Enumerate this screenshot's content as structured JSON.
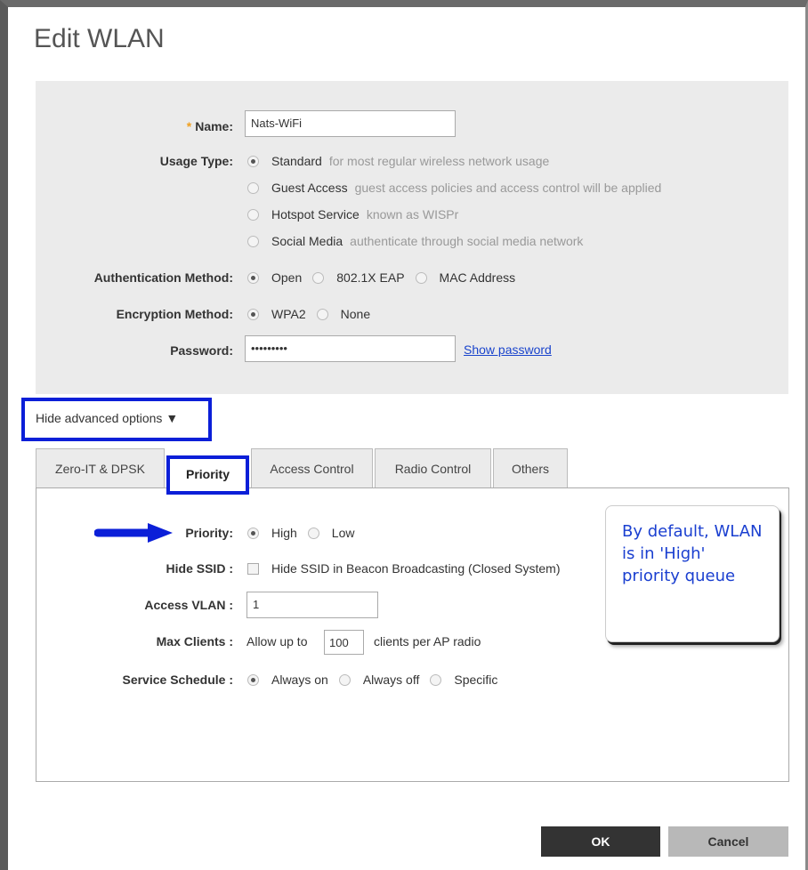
{
  "dialog": {
    "title": "Edit WLAN"
  },
  "general": {
    "name_label": "Name:",
    "name_required": "*",
    "name_value": "Nats-WiFi",
    "usage_label": "Usage Type:",
    "usage_options": [
      {
        "label": "Standard",
        "hint": "for most regular wireless network usage",
        "selected": true
      },
      {
        "label": "Guest Access",
        "hint": "guest access policies and access control will be applied",
        "selected": false
      },
      {
        "label": "Hotspot Service",
        "hint": "known as WISPr",
        "selected": false
      },
      {
        "label": "Social Media",
        "hint": "authenticate through social media network",
        "selected": false
      }
    ],
    "auth_label": "Authentication Method:",
    "auth_options": [
      "Open",
      "802.1X EAP",
      "MAC Address"
    ],
    "auth_selected": "Open",
    "enc_label": "Encryption Method:",
    "enc_options": [
      "WPA2",
      "None"
    ],
    "enc_selected": "WPA2",
    "password_label": "Password:",
    "password_value": "•••••••••",
    "show_password": "Show password"
  },
  "advanced": {
    "toggle_label": "Hide advanced options ▼",
    "tabs": [
      "Zero-IT & DPSK",
      "Priority",
      "Access Control",
      "Radio Control",
      "Others"
    ],
    "active_tab": "Priority"
  },
  "priority_tab": {
    "priority_label": "Priority:",
    "priority_options": [
      "High",
      "Low"
    ],
    "priority_selected": "High",
    "hide_ssid_label": "Hide SSID :",
    "hide_ssid_text": "Hide SSID in Beacon Broadcasting (Closed System)",
    "hide_ssid_checked": false,
    "vlan_label": "Access VLAN :",
    "vlan_value": "1",
    "max_clients_label": "Max Clients :",
    "max_clients_prefix": "Allow up to",
    "max_clients_value": "100",
    "max_clients_suffix": "clients per AP radio",
    "schedule_label": "Service Schedule :",
    "schedule_options": [
      "Always on",
      "Always off",
      "Specific"
    ],
    "schedule_selected": "Always on"
  },
  "annotation": {
    "callout_text": "By default, WLAN is in 'High' priority queue",
    "highlight_color": "#0b1fd8",
    "callout_text_color": "#1a3fd0"
  },
  "buttons": {
    "ok": "OK",
    "cancel": "Cancel"
  }
}
